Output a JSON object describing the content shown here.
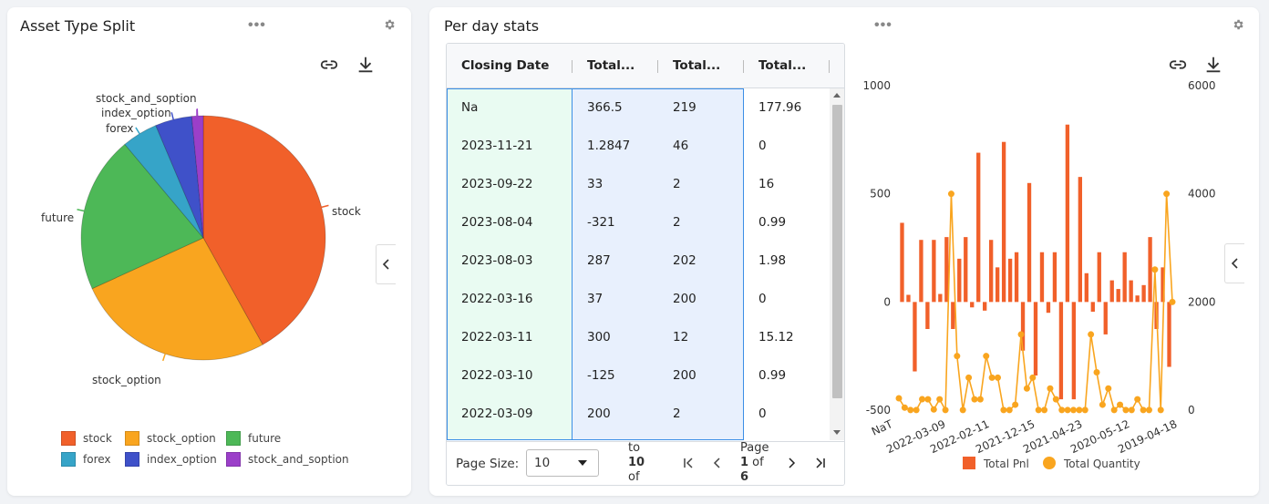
{
  "asset_card": {
    "title": "Asset Type Split",
    "menu_label": "•••",
    "legend": [
      {
        "label": "stock",
        "color": "#f1602a"
      },
      {
        "label": "stock_option",
        "color": "#f9a51f"
      },
      {
        "label": "future",
        "color": "#4db857"
      },
      {
        "label": "forex",
        "color": "#36a4c8"
      },
      {
        "label": "index_option",
        "color": "#3f51c9"
      },
      {
        "label": "stock_and_soption",
        "color": "#9b3fc9"
      }
    ]
  },
  "stats_card": {
    "title": "Per day stats",
    "menu_label": "•••",
    "grid": {
      "columns": [
        "Closing Date",
        "Total...",
        "Total...",
        "Total..."
      ],
      "rows": [
        [
          "Na",
          "366.5",
          "219",
          "177.96"
        ],
        [
          "2023-11-21",
          "1.2847",
          "46",
          "0"
        ],
        [
          "2023-09-22",
          "33",
          "2",
          "16"
        ],
        [
          "2023-08-04",
          "-321",
          "2",
          "0.99"
        ],
        [
          "2023-08-03",
          "287",
          "202",
          "1.98"
        ],
        [
          "2022-03-16",
          "37",
          "200",
          "0"
        ],
        [
          "2022-03-11",
          "300",
          "12",
          "15.12"
        ],
        [
          "2022-03-10",
          "-125",
          "200",
          "0.99"
        ],
        [
          "2022-03-09",
          "200",
          "2",
          "0"
        ]
      ],
      "pager": {
        "page_size_label": "Page Size:",
        "page_size_value": "10",
        "to_line1": "to",
        "to_line2": "10",
        "to_line3": "of",
        "page_line1": "Page",
        "page_line2a": "1",
        "page_line2b": " of",
        "page_line3": "6"
      }
    }
  },
  "chart_data": [
    {
      "type": "pie",
      "labels": [
        "stock",
        "stock_option",
        "future",
        "forex",
        "index_option",
        "stock_and_soption"
      ],
      "values": [
        41.5,
        26.0,
        20.5,
        4.7,
        4.8,
        1.5
      ],
      "colors": [
        "#f1602a",
        "#f9a51f",
        "#4db857",
        "#36a4c8",
        "#3f51c9",
        "#9b3fc9"
      ],
      "legend_position": "bottom"
    },
    {
      "type": "bar+line",
      "x_tick_labels": [
        "NaT",
        "2022-03-09",
        "2022-02-11",
        "2021-12-15",
        "2021-04-23",
        "2020-05-12",
        "2019-04-18"
      ],
      "y_left_ticks": [
        "1000",
        "500",
        "0",
        "-500"
      ],
      "y_left_range": [
        -500,
        1000
      ],
      "y_right_ticks": [
        "6000",
        "4000",
        "2000",
        "0"
      ],
      "y_right_range": [
        0,
        6000
      ],
      "series": [
        {
          "name": "Total Pnl",
          "color": "#f1602a",
          "type": "bar",
          "values": [
            366,
            33,
            -321,
            287,
            -125,
            287,
            37,
            300,
            -125,
            200,
            300,
            -25,
            690,
            -40,
            287,
            160,
            740,
            200,
            230,
            -225,
            550,
            -340,
            230,
            -50,
            230,
            -450,
            820,
            -450,
            578,
            133,
            -45,
            230,
            -150,
            100,
            60,
            230,
            100,
            30,
            78,
            300,
            -125,
            160,
            -300
          ]
        },
        {
          "name": "Total Quantity",
          "color": "#f9a51f",
          "type": "line",
          "values": [
            219,
            46,
            2,
            2,
            202,
            200,
            12,
            200,
            2,
            4000,
            1000,
            2,
            600,
            200,
            200,
            1000,
            600,
            600,
            2,
            2,
            100,
            1400,
            400,
            600,
            2,
            2,
            400,
            200,
            2,
            2,
            2,
            2,
            2,
            1400,
            700,
            100,
            400,
            2,
            100,
            2,
            2,
            200,
            2,
            2,
            2600,
            2,
            4000,
            2000
          ]
        }
      ],
      "legend_position": "bottom"
    }
  ]
}
